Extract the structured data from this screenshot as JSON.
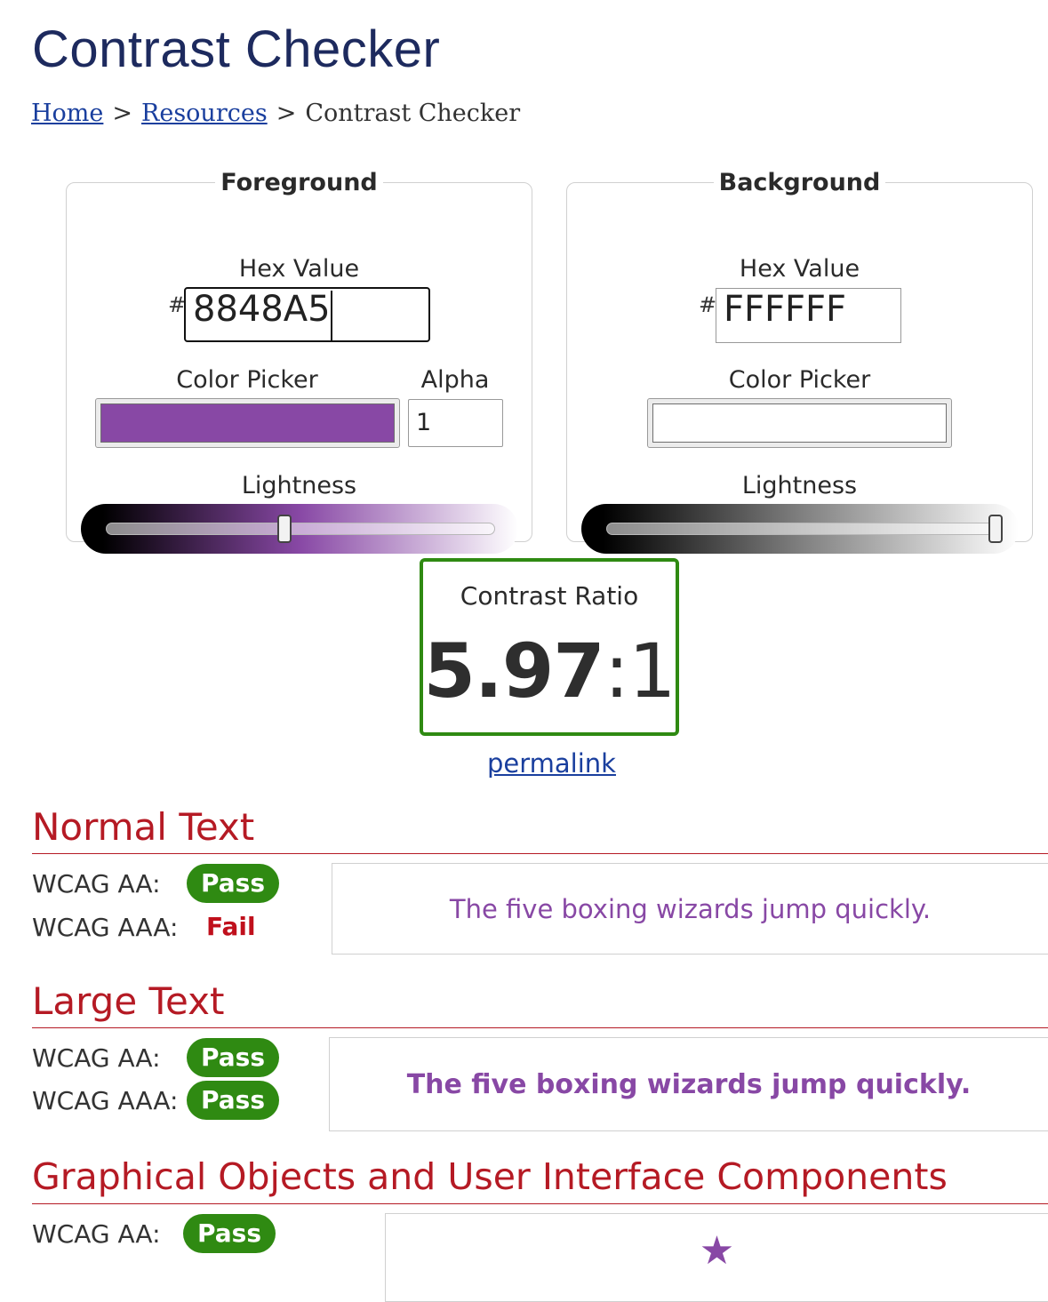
{
  "page": {
    "title": "Contrast Checker"
  },
  "breadcrumb": {
    "home": "Home",
    "resources": "Resources",
    "current": "Contrast Checker",
    "sep": ">"
  },
  "foreground": {
    "legend": "Foreground",
    "hex_label": "Hex Value",
    "hash": "#",
    "hex_value": "8848A5",
    "picker_label": "Color Picker",
    "alpha_label": "Alpha",
    "alpha_value": "1",
    "lightness_label": "Lightness",
    "color": "#8848A5",
    "lightness_level": 0.46
  },
  "background": {
    "legend": "Background",
    "hex_label": "Hex Value",
    "hash": "#",
    "hex_value": "FFFFFF",
    "picker_label": "Color Picker",
    "lightness_label": "Lightness",
    "color": "#FFFFFF",
    "lightness_level": 1.0
  },
  "contrast": {
    "label": "Contrast Ratio",
    "value": "5.97",
    "colon": ":",
    "one": "1",
    "permalink": "permalink",
    "border_color": "#2f8a12"
  },
  "normal_text": {
    "title": "Normal Text",
    "aa_label": "WCAG AA:",
    "aa_result": "Pass",
    "aaa_label": "WCAG AAA:",
    "aaa_result": "Fail",
    "sample": "The five boxing wizards jump quickly."
  },
  "large_text": {
    "title": "Large Text",
    "aa_label": "WCAG AA:",
    "aa_result": "Pass",
    "aaa_label": "WCAG AAA:",
    "aaa_result": "Pass",
    "sample": "The five boxing wizards jump quickly."
  },
  "graphical": {
    "title": "Graphical Objects and User Interface Components",
    "aa_label": "WCAG AA:",
    "aa_result": "Pass",
    "icon": "star-icon"
  },
  "colors": {
    "pass": "#2f8a12",
    "fail": "#c0101c",
    "heading": "#b51a24",
    "title": "#1d2a5e",
    "link": "#1a3f9e"
  }
}
